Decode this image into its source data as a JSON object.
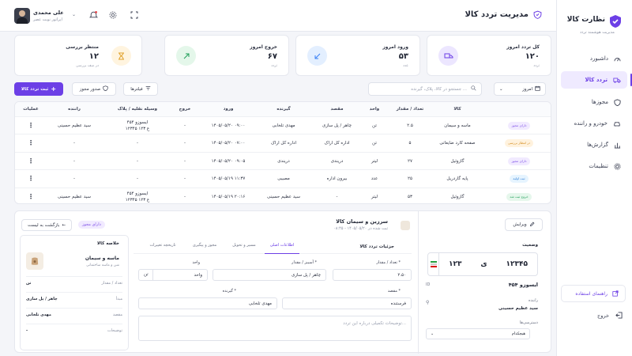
{
  "brand": {
    "title": "نظارت کالا",
    "subtitle": "مدیریت هوشمند تردد"
  },
  "nav": [
    {
      "label": "داشبورد",
      "icon": "dashboard-icon"
    },
    {
      "label": "تردد کالا",
      "icon": "truck-icon",
      "active": true
    },
    {
      "label": "مجوزها",
      "icon": "shield-icon"
    },
    {
      "label": "خودرو و راننده",
      "icon": "car-icon"
    },
    {
      "label": "گزارش‌ها",
      "icon": "chart-icon"
    },
    {
      "label": "تنظیمات",
      "icon": "gear-icon"
    }
  ],
  "help": "راهنمای استفاده",
  "logout": "خروج",
  "header": {
    "title": "مدیریت تردد کالا",
    "user_name": "علی محمدی",
    "user_role": "اپراتور نوبت عصر"
  },
  "stats": [
    {
      "label": "کل تردد امروز",
      "value": "۱۲۰",
      "unit": "تردد",
      "color": "#ece6ff",
      "fg": "#6c3fe6"
    },
    {
      "label": "ورود امروز",
      "value": "۵۳",
      "unit": "عدد",
      "color": "#e3efff",
      "fg": "#3b82f6"
    },
    {
      "label": "خروج امروز",
      "value": "۶۷",
      "unit": "تردد",
      "color": "#e4f7ea",
      "fg": "#22a05b"
    },
    {
      "label": "منتظر بررسی",
      "value": "۱۲",
      "unit": "در صف بررسی",
      "color": "#fff4df",
      "fg": "#e0a12a"
    }
  ],
  "toolbar": {
    "period": "امروز",
    "search_placeholder": "جستجو در کالا، پلاک، گیرنده ...",
    "filters": "فیلترها",
    "permit": "صدور مجوز",
    "new": "ثبت تردد کالا"
  },
  "table": {
    "headers": [
      "کالا",
      "تعداد / مقدار",
      "واحد",
      "مقصد",
      "گیرنده",
      "ورود",
      "خروج",
      "وسیله نقلیه / پلاک",
      "راننده",
      "عملیات"
    ],
    "rows": [
      {
        "badge": "دارای مجوز",
        "badge_bg": "#f1eaff",
        "badge_fg": "#7b4ce6",
        "item": "ماسه و سیمان",
        "qty": "۲.۵",
        "unit": "تن",
        "dest": "چاهر / پل سازی",
        "recv": "مهدی تلخابی",
        "in": "۱۴۰۵/۰۵/۲۰ ۰۹:۰۰",
        "out": "-",
        "vehicle": "ایسوزو ۴۵۴\n۱۲۳۴۵ ع ۱۲۳",
        "driver": "سید عظیم حسینی"
      },
      {
        "badge": "در انتظار بررسی",
        "badge_bg": "#fff2de",
        "badge_fg": "#d28a1c",
        "item": "صفحه کارد ضایعاتی",
        "qty": "۵",
        "unit": "تن",
        "dest": "اداره کل اراک",
        "recv": "اداره کل اراک",
        "in": "۱۴۰۵/۰۵/۲۰ ۰۷:۰۰",
        "out": "-",
        "vehicle": "-",
        "driver": "-"
      },
      {
        "badge": "دارای مجوز",
        "badge_bg": "#f1eaff",
        "badge_fg": "#7b4ce6",
        "item": "گازوئیل",
        "qty": "۲۷",
        "unit": "لیتر",
        "dest": "دریندی",
        "recv": "دریندی",
        "in": "۱۴۰۵/۰۵/۲۰ ۰۹:۰۵",
        "out": "-",
        "vehicle": "-",
        "driver": "-"
      },
      {
        "badge": "ثبت اولیه",
        "badge_bg": "#e6f4ff",
        "badge_fg": "#2f7fd8",
        "item": "پایه گاردریل",
        "qty": "۲۵",
        "unit": "عدد",
        "dest": "بیرون اداره",
        "recv": "مصیبی",
        "in": "۱۴۰۵/۰۵/۱۹ ۱۱:۳۷",
        "out": "-",
        "vehicle": "-",
        "driver": "-"
      },
      {
        "badge": "خروج ثبت شد",
        "badge_bg": "#e6f7ec",
        "badge_fg": "#22a05b",
        "item": "گازوئیل",
        "qty": "۵۳",
        "unit": "لیتر",
        "dest": "-",
        "recv": "سید عظیم حسینی",
        "in": "۱۴۰۵/۰۵/۱۹ ۲۰:۱۶",
        "out": "-",
        "vehicle": "ایسوزو ۴۵۴\n۱۲۳۴۵ ع ۱۲۳",
        "driver": "سید عظیم حسینی"
      }
    ]
  },
  "detail": {
    "edit": "ویرایش",
    "status_label": "وضعیت",
    "plate_num": "۱۲۳۴۵",
    "plate_letter": "ی",
    "plate_code": "۱۲۳",
    "vehicle": "ایسوزو ۴۵۴",
    "vehicle_icon_label": "ID",
    "driver_label": "راننده",
    "driver": "سید عظیم حسینی",
    "permit_label": "دسترسی‌ها",
    "permit_value": "هیچکدام",
    "title": "سرزین و سیمان کالا",
    "subtitle": "ثبت شده در ۱۴۰۵/۰۵/۲۰ - ۰۸:۴۵",
    "tabs": [
      "اطلاعات اصلی",
      "مسیر و تحویل",
      "مجوز و پیگیری",
      "تاریخچه تغییرات"
    ],
    "section": "جزئیات تردد کالا",
    "f_qty_label": "تعداد / مقدار *",
    "f_qty": "۲.۵۰",
    "f_item_label": "آسیبز / مقدار *",
    "f_item": "چاهر / پل سازی",
    "f_unit_label": "واحد",
    "f_unit": "واحد",
    "f_unit_suffix": "تن",
    "f_dest_label": "مقصد *",
    "f_dest": "فرستنده",
    "f_recv_label": "گیرنده *",
    "f_recv": "مهدی تلخابی",
    "f_notes": "توضیحات تکمیلی درباره این تردد...",
    "back": "بازگشت به لیست",
    "badge": "دارای مجوز",
    "summary_title": "خلاصه کالا",
    "summary_name": "ماسه و سیمان",
    "summary_sub": "شن و ماسه ساختمانی",
    "summary_rows": [
      {
        "k": "تعداد / مقدار",
        "v": "تن"
      },
      {
        "k": "مبدأ",
        "v": "چاهر / پل سازی"
      },
      {
        "k": "مقصد",
        "v": "مهدی تلخابی"
      },
      {
        "k": "توضیحات",
        "v": "-"
      }
    ]
  }
}
